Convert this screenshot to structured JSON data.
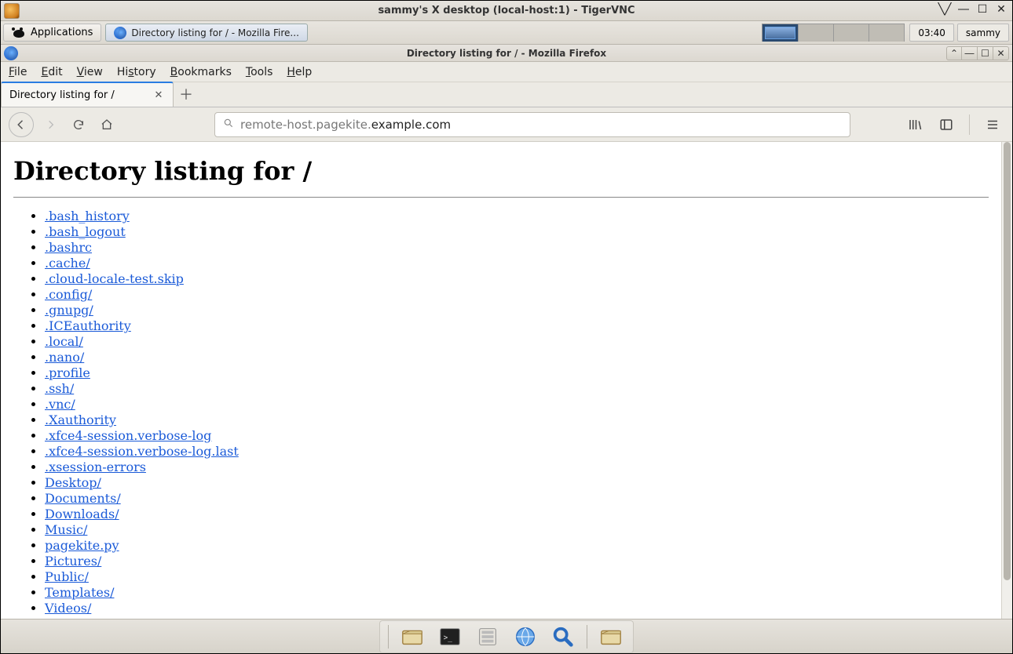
{
  "vnc": {
    "title": "sammy's X desktop (local-host:1) - TigerVNC"
  },
  "xfce": {
    "apps_label": "Applications",
    "task_firefox": "Directory listing for / - Mozilla Fire...",
    "clock": "03:40",
    "user": "sammy"
  },
  "firefox": {
    "window_title": "Directory listing for / - Mozilla Firefox",
    "menus": {
      "file": "File",
      "edit": "Edit",
      "view": "View",
      "history": "History",
      "bookmarks": "Bookmarks",
      "tools": "Tools",
      "help": "Help"
    },
    "tab_label": "Directory listing for /",
    "url_dim": "remote-host.pagekite.",
    "url_dark": "example.com"
  },
  "page": {
    "heading": "Directory listing for /",
    "files": [
      ".bash_history",
      ".bash_logout",
      ".bashrc",
      ".cache/",
      ".cloud-locale-test.skip",
      ".config/",
      ".gnupg/",
      ".ICEauthority",
      ".local/",
      ".nano/",
      ".profile",
      ".ssh/",
      ".vnc/",
      ".Xauthority",
      ".xfce4-session.verbose-log",
      ".xfce4-session.verbose-log.last",
      ".xsession-errors",
      "Desktop/",
      "Documents/",
      "Downloads/",
      "Music/",
      "pagekite.py",
      "Pictures/",
      "Public/",
      "Templates/",
      "Videos/"
    ]
  }
}
